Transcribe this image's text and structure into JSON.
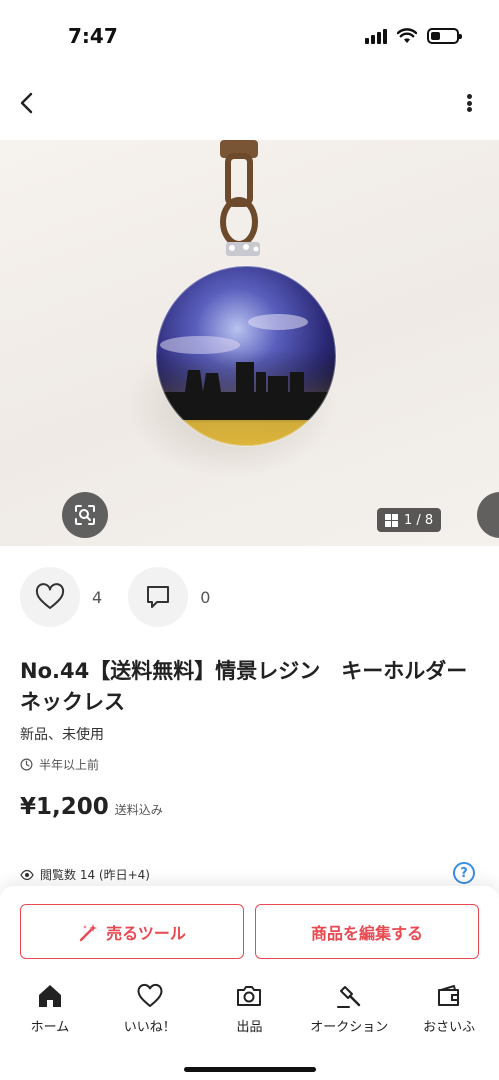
{
  "status_bar": {
    "time": "7:47"
  },
  "gallery": {
    "counter": "1 / 8"
  },
  "actions": {
    "likes": "4",
    "comments": "0"
  },
  "item": {
    "title": "No.44【送料無料】情景レジン　キーホルダー　ネックレス",
    "condition": "新品、未使用",
    "posted": "半年以上前",
    "price": "¥1,200",
    "shipping": "送料込み",
    "views": "閲覧数  14 (昨日+4)"
  },
  "buttons": {
    "sell_tool": "売るツール",
    "edit_item": "商品を編集する"
  },
  "tabbar": {
    "items": [
      {
        "label": "ホーム",
        "icon": "home-icon"
      },
      {
        "label": "いいね！",
        "icon": "heart-icon"
      },
      {
        "label": "出品",
        "icon": "camera-icon"
      },
      {
        "label": "オークション",
        "icon": "gavel-icon"
      },
      {
        "label": "おさいふ",
        "icon": "wallet-icon"
      }
    ]
  },
  "colors": {
    "accent": "#e94a52",
    "help": "#3a8ee6"
  }
}
